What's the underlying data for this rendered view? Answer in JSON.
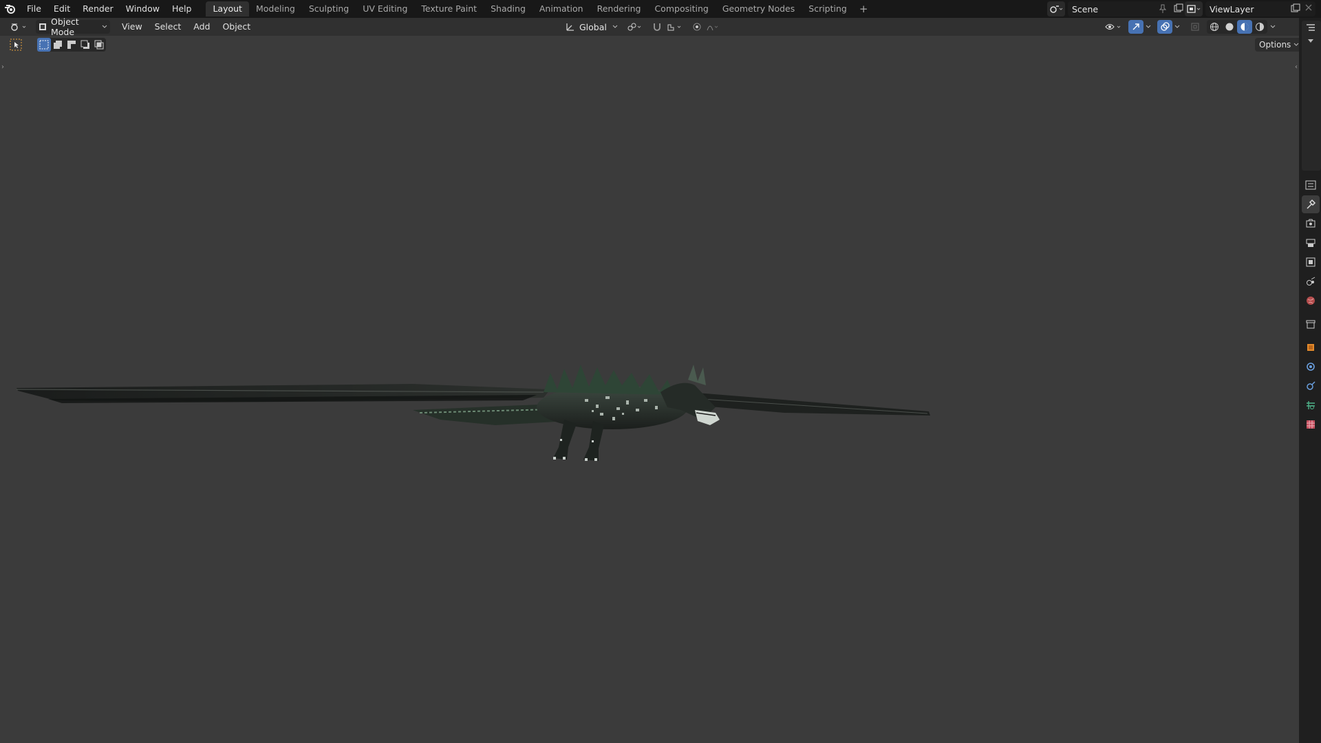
{
  "menu": [
    "File",
    "Edit",
    "Render",
    "Window",
    "Help"
  ],
  "workspace_tabs": [
    "Layout",
    "Modeling",
    "Sculpting",
    "UV Editing",
    "Texture Paint",
    "Shading",
    "Animation",
    "Rendering",
    "Compositing",
    "Geometry Nodes",
    "Scripting"
  ],
  "active_tab": "Layout",
  "scene": {
    "name": "Scene"
  },
  "view_layer": {
    "name": "ViewLayer"
  },
  "header": {
    "mode": "Object Mode",
    "menus": [
      "View",
      "Select",
      "Add",
      "Object"
    ],
    "orientation": "Global"
  },
  "toolbar": {
    "options_label": "Options"
  },
  "colors": {
    "accent": "#4772b3",
    "topbar": "#181818",
    "header": "#303030",
    "viewport": "#3b3b3b"
  },
  "properties_tabs": [
    "tool-icon",
    "render-icon",
    "output-icon",
    "view-layer-icon",
    "scene-icon",
    "world-icon",
    "collection-icon",
    "object-icon",
    "modifier-icon",
    "particles-icon",
    "physics-icon",
    "texture-icon"
  ]
}
